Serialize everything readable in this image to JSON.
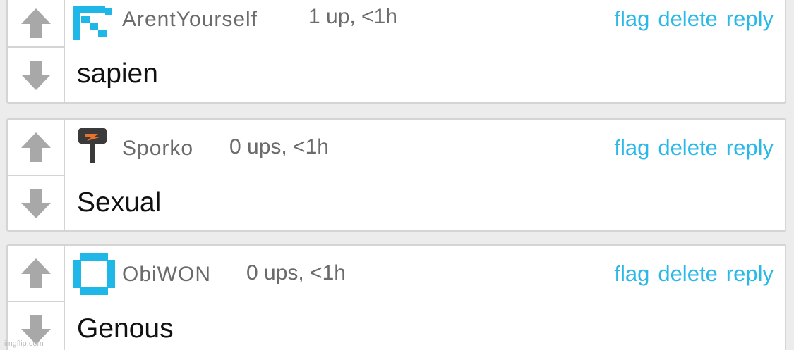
{
  "comments": [
    {
      "username": "ArentYourself",
      "meta": "1 up, <1h",
      "text": "sapien",
      "actions": {
        "flag": "flag",
        "delete": "delete",
        "reply": "reply"
      },
      "avatar_icon": "blue-pixel-avatar-icon",
      "avatar_color": "#1fb6e8"
    },
    {
      "username": "Sporko",
      "meta": "0 ups, <1h",
      "text": "Sexual",
      "actions": {
        "flag": "flag",
        "delete": "delete",
        "reply": "reply"
      },
      "avatar_icon": "sign-post-avatar-icon",
      "avatar_color": "#e8722a"
    },
    {
      "username": "ObiWON",
      "meta": "0 ups, <1h",
      "text": "Genous",
      "actions": {
        "flag": "flag",
        "delete": "delete",
        "reply": "reply"
      },
      "avatar_icon": "blue-square-ring-avatar-icon",
      "avatar_color": "#1fb6e8"
    }
  ],
  "colors": {
    "action_link": "#2ab8e8",
    "username": "#6b6b6b",
    "vote_arrow": "#a8a8a8",
    "border": "#d4d4d4"
  },
  "watermark": "imgflip.com"
}
